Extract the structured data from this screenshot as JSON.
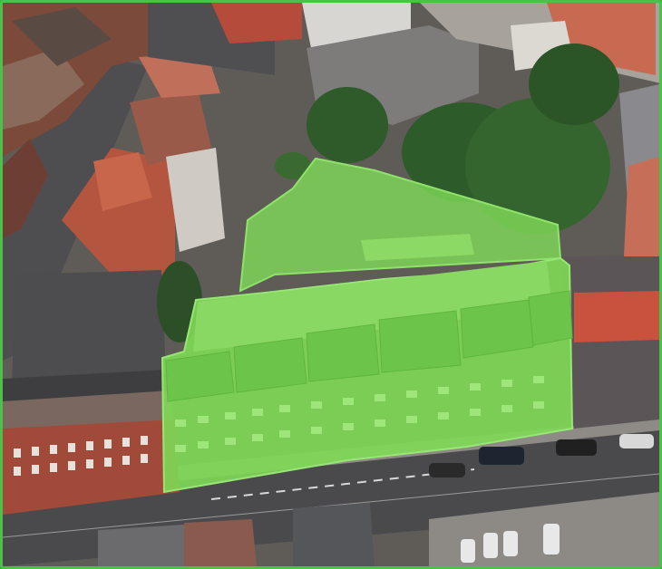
{
  "view": {
    "type": "aerial-3d",
    "highlight_color": "#7ed957",
    "frame_color": "#4cc14a",
    "highlighted_features": [
      "building-block",
      "garden-plot"
    ]
  }
}
